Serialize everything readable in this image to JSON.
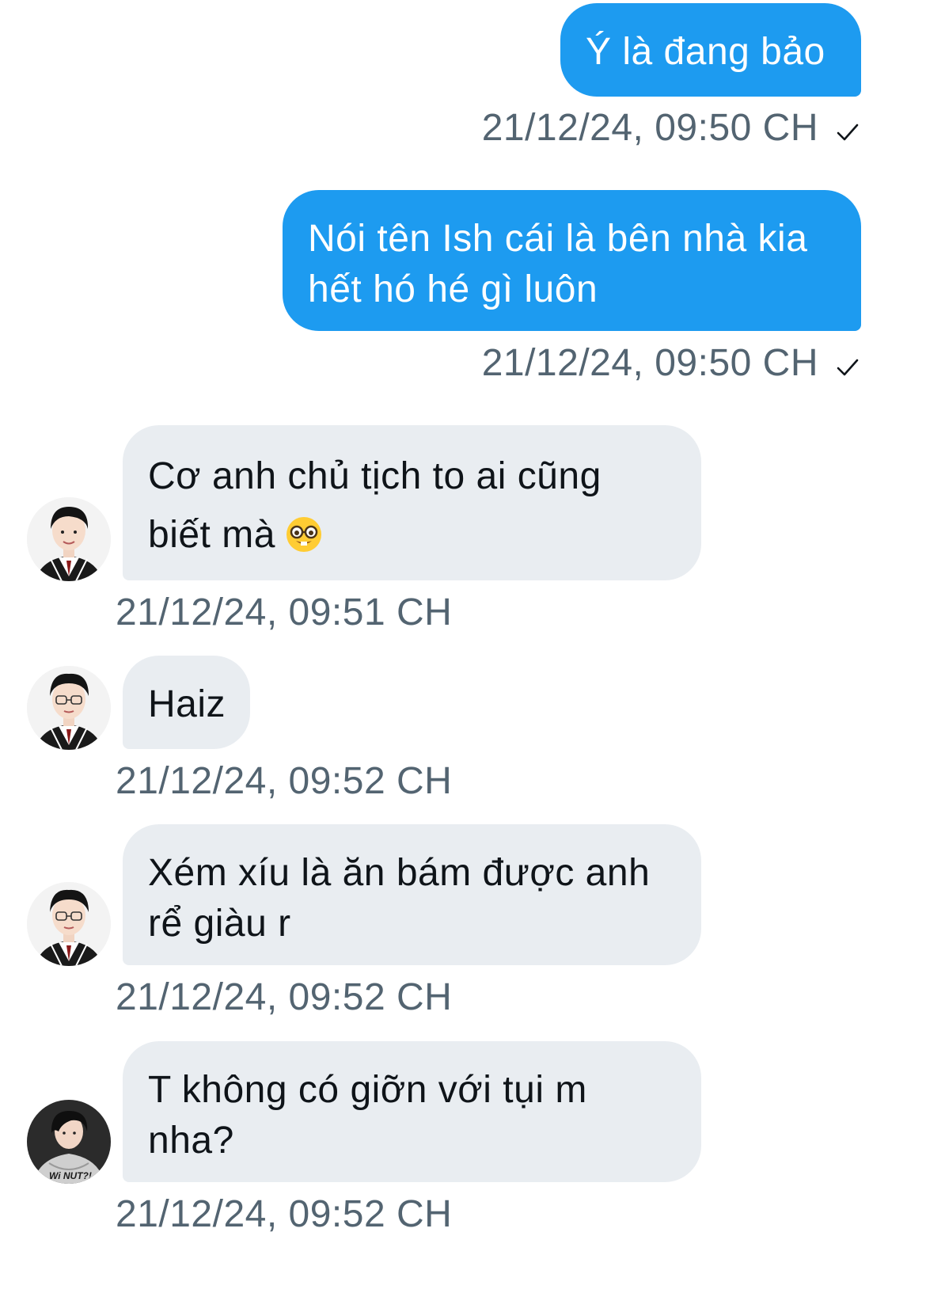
{
  "messages": [
    {
      "direction": "sent",
      "text": "Ý là đang bảo",
      "timestamp": "21/12/24, 09:50 CH"
    },
    {
      "direction": "sent",
      "text": "Nói tên Ish cái là bên nhà kia hết hó hé gì luôn",
      "timestamp": "21/12/24, 09:50 CH"
    },
    {
      "direction": "received",
      "text": "Cơ anh chủ tịch to ai cũng biết mà",
      "emoji": "nerd-face-emoji",
      "timestamp": "21/12/24, 09:51 CH"
    },
    {
      "direction": "received",
      "text": "Haiz",
      "timestamp": "21/12/24, 09:52 CH"
    },
    {
      "direction": "received",
      "text": "Xém xíu là ăn bám được anh rể giàu r",
      "timestamp": "21/12/24, 09:52 CH"
    },
    {
      "direction": "received",
      "text": "T không có giỡn với tụi m nha?",
      "timestamp": "21/12/24, 09:52 CH"
    }
  ],
  "icons": {
    "read_receipt": "checkmark-icon"
  },
  "colors": {
    "sent_bubble": "#1d9bf0",
    "received_bubble": "#e9edf1",
    "timestamp_text": "#536471"
  }
}
